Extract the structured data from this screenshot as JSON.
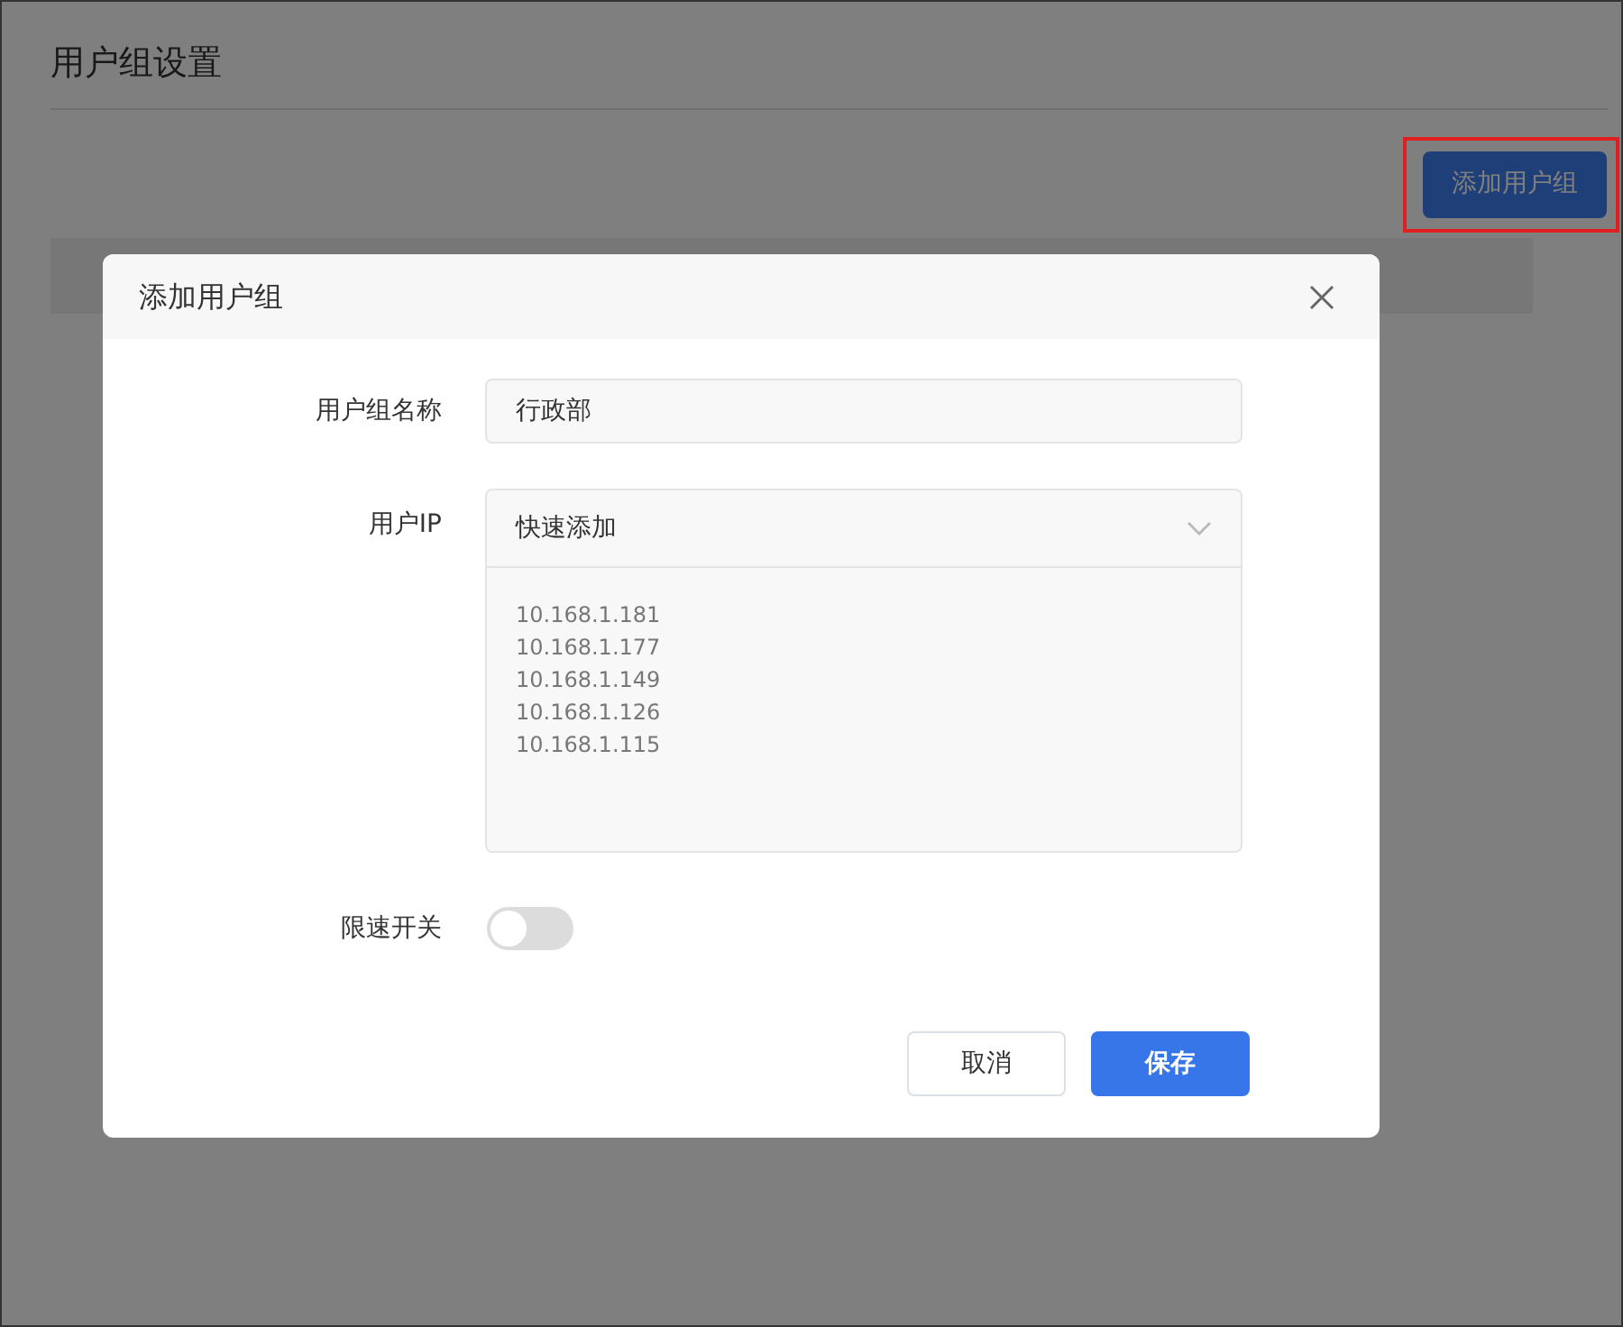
{
  "page": {
    "title": "用户组设置",
    "add_button": {
      "label": "添加用户组",
      "highlighted": true
    }
  },
  "dialog": {
    "title": "添加用户组",
    "name_field": {
      "label": "用户组名称",
      "value": "行政部"
    },
    "ip_field": {
      "label": "用户IP",
      "select_value": "快速添加",
      "ips": [
        "10.168.1.181",
        "10.168.1.177",
        "10.168.1.149",
        "10.168.1.126",
        "10.168.1.115"
      ]
    },
    "speed_limit": {
      "label": "限速开关",
      "on": false
    },
    "buttons": [
      {
        "label": "取消",
        "kind": "secondary"
      },
      {
        "label": "保存",
        "kind": "primary"
      }
    ]
  }
}
